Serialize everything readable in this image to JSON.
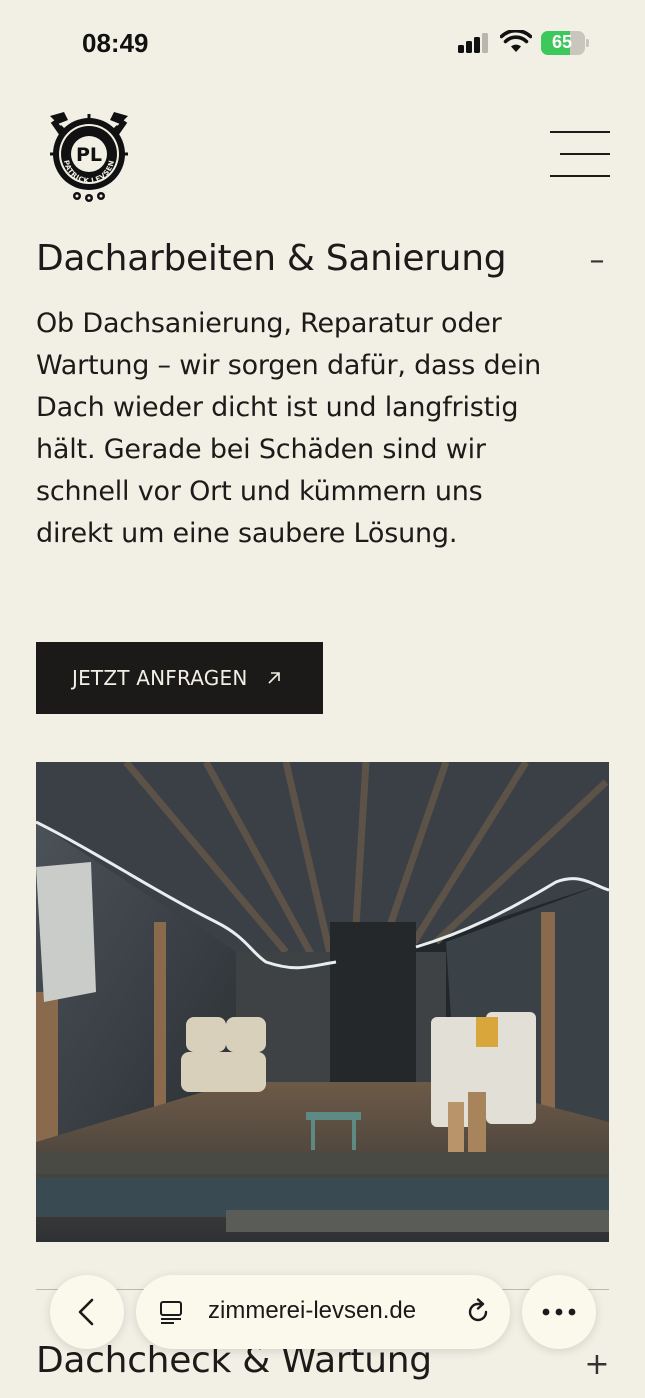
{
  "status_bar": {
    "time": "08:49",
    "battery_percent": "65",
    "battery_level": 0.65,
    "battery_color": "#3cc85a"
  },
  "header": {
    "logo_text": "PL",
    "logo_ring_text": "PATRICK LEVSEN",
    "menu_icon": "hamburger-menu-icon"
  },
  "accordion": [
    {
      "title": "Dacharbeiten & Sanierung",
      "toggle": "–",
      "expanded": true,
      "body": "Ob Dachsanierung, Reparatur oder Wartung – wir sorgen dafür, dass dein Dach wieder dicht ist und langfristig hält. Gerade bei Schäden sind wir schnell vor Ort und kümmern uns direkt um eine saubere Lösung.",
      "cta_label": "JETZT ANFRAGEN",
      "cta_icon": "arrow-up-right-icon"
    },
    {
      "title": "Dachcheck & Wartung",
      "toggle": "+",
      "expanded": false
    }
  ],
  "browser": {
    "url": "zimmerei-levsen.de",
    "back_icon": "chevron-left-icon",
    "page_icon": "reader-icon",
    "reload_icon": "reload-icon",
    "more_icon": "ellipsis-icon"
  },
  "colors": {
    "background": "#f2efe5",
    "button_dark": "#1b1a18",
    "text": "#1c1b19"
  }
}
